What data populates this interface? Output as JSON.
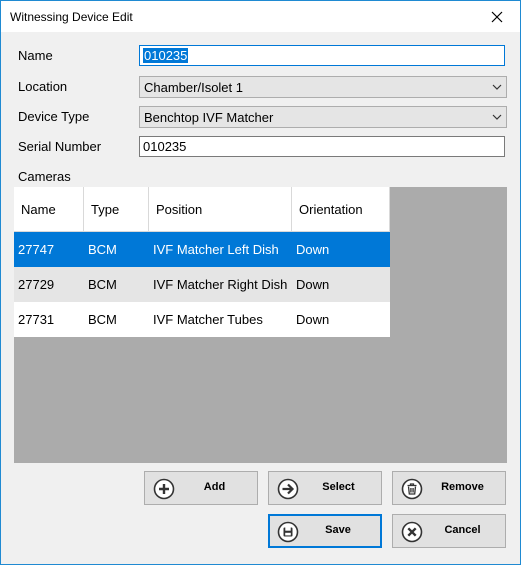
{
  "window": {
    "title": "Witnessing Device Edit"
  },
  "form": {
    "name_label": "Name",
    "name_value": "010235",
    "location_label": "Location",
    "location_value": "Chamber/Isolet 1",
    "device_type_label": "Device Type",
    "device_type_value": "Benchtop IVF Matcher",
    "serial_label": "Serial Number",
    "serial_value": "010235"
  },
  "cameras": {
    "label": "Cameras",
    "columns": [
      "Name",
      "Type",
      "Position",
      "Orientation"
    ],
    "rows": [
      {
        "name": "27747",
        "type": "BCM",
        "position": "IVF Matcher Left Dish",
        "orientation": "Down"
      },
      {
        "name": "27729",
        "type": "BCM",
        "position": "IVF Matcher Right Dish",
        "orientation": "Down"
      },
      {
        "name": "27731",
        "type": "BCM",
        "position": "IVF Matcher Tubes",
        "orientation": "Down"
      }
    ],
    "selected_row": "27747"
  },
  "buttons": {
    "add": "Add",
    "select": "Select",
    "remove": "Remove",
    "save": "Save",
    "cancel": "Cancel"
  },
  "colors": {
    "selection": "#0078d7",
    "window_border": "#1f8ad2",
    "grid_background": "#ababab"
  },
  "icons": {
    "close": "close-icon",
    "add": "plus-circle-icon",
    "select": "arrow-right-circle-icon",
    "remove": "trash-icon",
    "save": "floppy-disk-icon",
    "cancel": "x-circle-icon",
    "dropdown": "chevron-down-icon"
  }
}
